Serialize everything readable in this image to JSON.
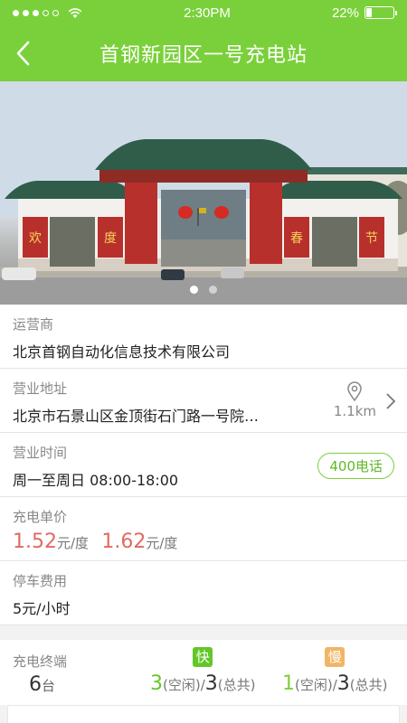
{
  "status_bar": {
    "time": "2:30PM",
    "battery": "22%",
    "battery_level": 0.22
  },
  "nav": {
    "title": "首钢新园区一号充电站"
  },
  "banner": {
    "slide_count": 2,
    "active_slide": 1,
    "sign_left": [
      "欢",
      "度"
    ],
    "sign_right": [
      "春",
      "节"
    ]
  },
  "operator": {
    "label": "运营商",
    "value": "北京首钢自动化信息技术有限公司"
  },
  "address": {
    "label": "营业地址",
    "value": "北京市石景山区金顶街石门路一号院…",
    "distance": "1.1km"
  },
  "hours": {
    "label": "营业时间",
    "value": "周一至周日 08:00-18:00",
    "phone_button": "400电话"
  },
  "price": {
    "label": "充电单价",
    "price1": "1.52",
    "price2": "1.62",
    "unit": "元/度"
  },
  "parking": {
    "label": "停车费用",
    "value": "5元/小时"
  },
  "terminals": {
    "label": "充电终端",
    "count": "6",
    "count_unit": "台",
    "fast": {
      "badge": "快",
      "idle": "3",
      "idle_label": "(空闲)/",
      "total": "3",
      "total_label": "(总共)"
    },
    "slow": {
      "badge": "慢",
      "idle": "1",
      "idle_label": "(空闲)/",
      "total": "3",
      "total_label": "(总共)"
    }
  },
  "colors": {
    "brand": "#7ad03a",
    "price": "#e06a62",
    "slow_badge": "#f2b565"
  }
}
